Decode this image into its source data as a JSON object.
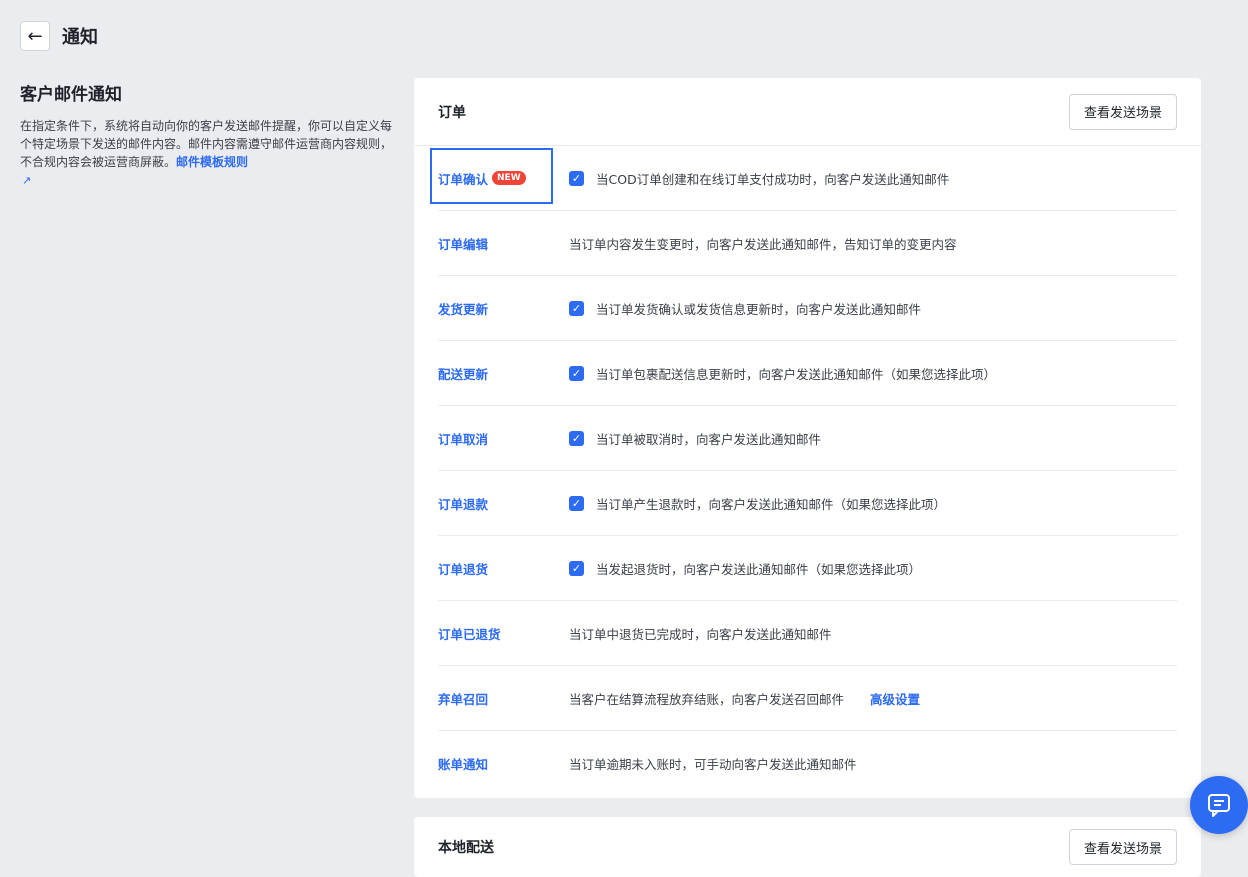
{
  "header": {
    "back_icon": "arrow-left-icon",
    "title": "通知"
  },
  "sidebar": {
    "heading": "客户邮件通知",
    "description": "在指定条件下，系统将自动向你的客户发送邮件提醒，你可以自定义每个特定场景下发送的邮件内容。邮件内容需遵守邮件运营商内容规则，不合规内容会被运营商屏蔽。",
    "link_label": "邮件模板规则",
    "link_icon": "external-link-icon"
  },
  "orders_card": {
    "title": "订单",
    "scene_button": "查看发送场景",
    "rows": [
      {
        "label": "订单确认",
        "badge": "NEW",
        "checked": true,
        "desc": "当COD订单创建和在线订单支付成功时，向客户发送此通知邮件"
      },
      {
        "label": "订单编辑",
        "checked": false,
        "desc": "当订单内容发生变更时，向客户发送此通知邮件，告知订单的变更内容"
      },
      {
        "label": "发货更新",
        "checked": true,
        "desc": "当订单发货确认或发货信息更新时，向客户发送此通知邮件"
      },
      {
        "label": "配送更新",
        "checked": true,
        "desc": "当订单包裹配送信息更新时，向客户发送此通知邮件（如果您选择此项）"
      },
      {
        "label": "订单取消",
        "checked": true,
        "desc": "当订单被取消时，向客户发送此通知邮件"
      },
      {
        "label": "订单退款",
        "checked": true,
        "desc": "当订单产生退款时，向客户发送此通知邮件（如果您选择此项）"
      },
      {
        "label": "订单退货",
        "checked": true,
        "desc": "当发起退货时，向客户发送此通知邮件（如果您选择此项）"
      },
      {
        "label": "订单已退货",
        "checked": false,
        "desc": "当订单中退货已完成时，向客户发送此通知邮件"
      },
      {
        "label": "弃单召回",
        "checked": false,
        "desc": "当客户在结算流程放弃结账，向客户发送召回邮件",
        "link": "高级设置"
      },
      {
        "label": "账单通知",
        "checked": false,
        "desc": "当订单逾期未入账时，可手动向客户发送此通知邮件"
      }
    ]
  },
  "local_card": {
    "title": "本地配送",
    "scene_button": "查看发送场景"
  },
  "chat": {
    "icon": "chat-icon"
  },
  "colors": {
    "accent": "#2c6bf2",
    "badge": "#f04437",
    "background": "#eaecf0"
  }
}
